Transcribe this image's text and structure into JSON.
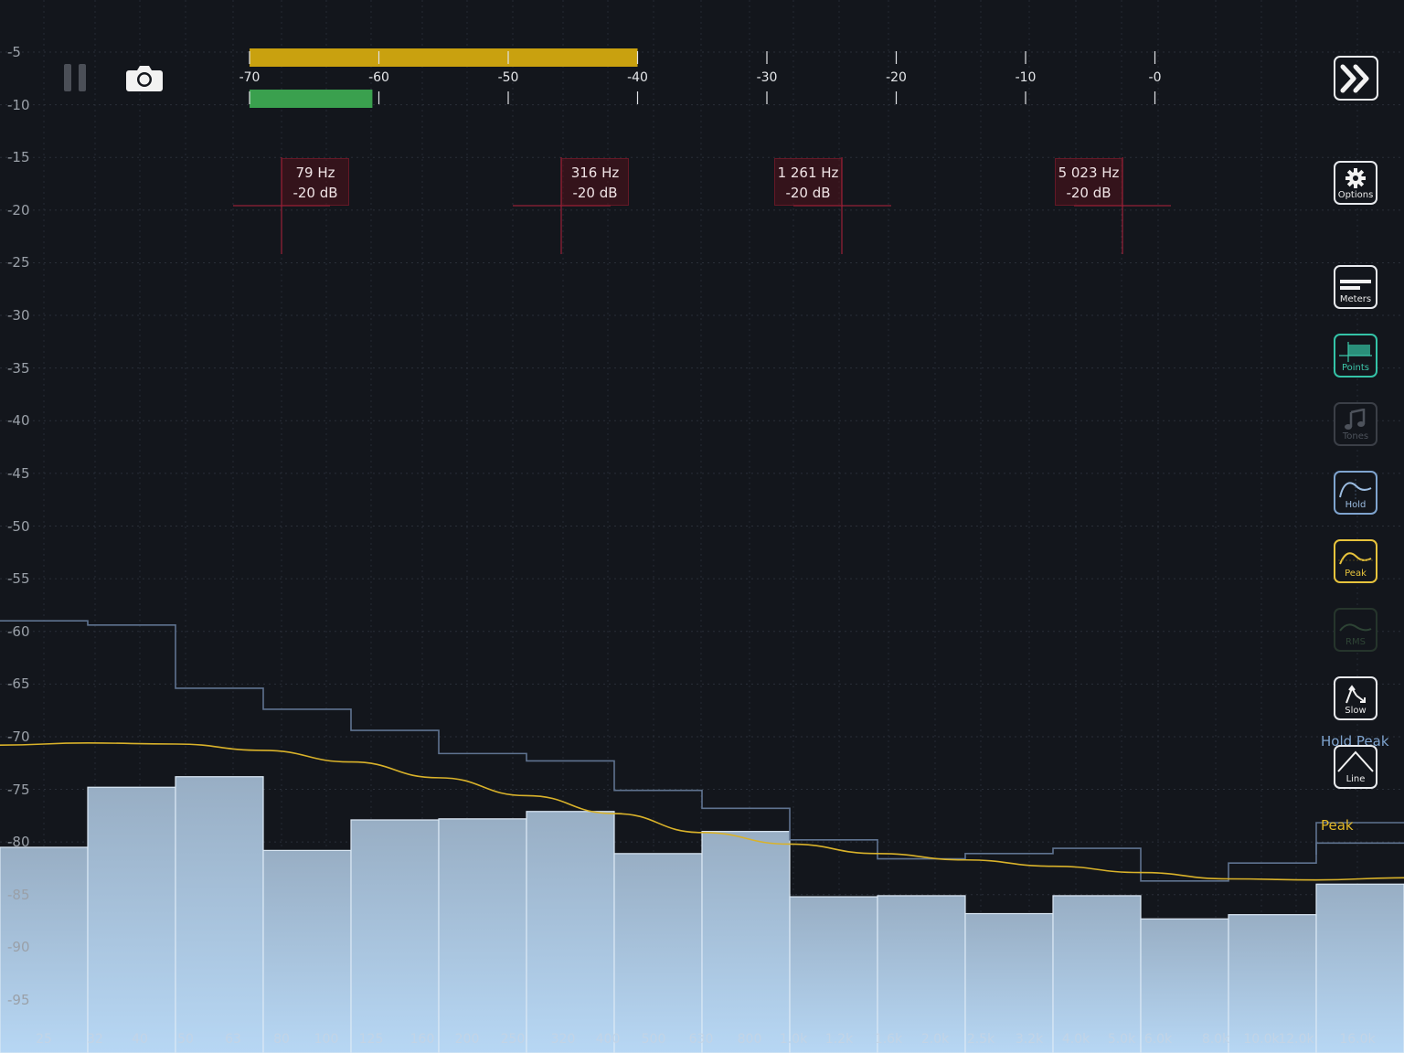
{
  "y_axis": {
    "labels": [
      "-5",
      "-10",
      "-15",
      "-20",
      "-25",
      "-30",
      "-35",
      "-40",
      "-45",
      "-50",
      "-55",
      "-60",
      "-65",
      "-70",
      "-75",
      "-80",
      "-85",
      "-90",
      "-95"
    ]
  },
  "x_axis": {
    "labels": [
      "25",
      "32",
      "40",
      "50",
      "63",
      "80",
      "100",
      "125",
      "160",
      "200",
      "250",
      "320",
      "400",
      "500",
      "630",
      "800",
      "1.0k",
      "1.2k",
      "1.6k",
      "2.0k",
      "2.5k",
      "3.2k",
      "4.0k",
      "5.0k",
      "6.0k",
      "8.0k",
      "10.0k",
      "12.0k",
      "16.0k"
    ]
  },
  "level_meter": {
    "scale_labels": [
      "-70",
      "-60",
      "-50",
      "-40",
      "-30",
      "-20",
      "-10",
      "-0"
    ],
    "peak_level_db": -40,
    "rms_level_db": -60.5,
    "peak_color": "#c9a10f",
    "rms_color": "#3aa04e"
  },
  "markers": [
    {
      "freq": "79 Hz",
      "level": "-20 dB"
    },
    {
      "freq": "316 Hz",
      "level": "-20 dB"
    },
    {
      "freq": "1 261 Hz",
      "level": "-20 dB"
    },
    {
      "freq": "5 023 Hz",
      "level": "-20 dB"
    }
  ],
  "toolbar": {
    "pause_icon": "pause-icon",
    "camera_icon": "camera-icon",
    "forward_icon": "double-chevron-right-icon"
  },
  "side_buttons": [
    {
      "id": "options",
      "label": "Options",
      "icon": "gear-icon",
      "state": "normal"
    },
    {
      "id": "meters",
      "label": "Meters",
      "icon": "meters-icon",
      "state": "normal"
    },
    {
      "id": "points",
      "label": "Points",
      "icon": "points-icon",
      "state": "active-teal"
    },
    {
      "id": "tones",
      "label": "Tones",
      "icon": "music-note-icon",
      "state": "disabled"
    },
    {
      "id": "hold",
      "label": "Hold",
      "icon": "hold-curve-icon",
      "state": "active-blue"
    },
    {
      "id": "peak",
      "label": "Peak",
      "icon": "peak-curve-icon",
      "state": "active-yellow"
    },
    {
      "id": "rms",
      "label": "RMS",
      "icon": "rms-curve-icon",
      "state": "disabled"
    },
    {
      "id": "slow",
      "label": "Slow",
      "icon": "slow-arrows-icon",
      "state": "normal"
    },
    {
      "id": "line",
      "label": "Line",
      "icon": "line-peak-icon",
      "state": "normal"
    }
  ],
  "curve_labels": {
    "hold_peak": "Hold Peak",
    "peak": "Peak",
    "hold_peak_color": "#7fa4cf",
    "peak_color": "#e2b928"
  },
  "chart_data": {
    "type": "bar",
    "bands": [
      "25",
      "32",
      "40",
      "50",
      "63",
      "80",
      "100",
      "125",
      "160",
      "200",
      "250",
      "320",
      "400",
      "500",
      "630",
      "800"
    ],
    "bar_values_db": [
      -80.5,
      -74.8,
      -73.8,
      -80.8,
      -77.9,
      -77.8,
      -77.1,
      -81.1,
      -79.0,
      -85.2,
      -85.1,
      -86.8,
      -85.1,
      -87.3,
      -86.9,
      -84.0
    ],
    "hold_values_db": [
      -59.0,
      -59.4,
      -65.4,
      -67.4,
      -69.4,
      -71.6,
      -72.3,
      -75.1,
      -76.8,
      -79.8,
      -81.6,
      -81.1,
      -80.6,
      -83.7,
      -82.0,
      -80.1
    ],
    "peak_curve_db": [
      -70.8,
      -70.6,
      -70.7,
      -71.3,
      -72.4,
      -73.9,
      -75.6,
      -77.3,
      -79.1,
      -80.2,
      -81.1,
      -81.7,
      -82.3,
      -82.9,
      -83.5,
      -83.6,
      -83.4
    ],
    "ylim": [
      -100,
      -3
    ],
    "grid": true
  }
}
